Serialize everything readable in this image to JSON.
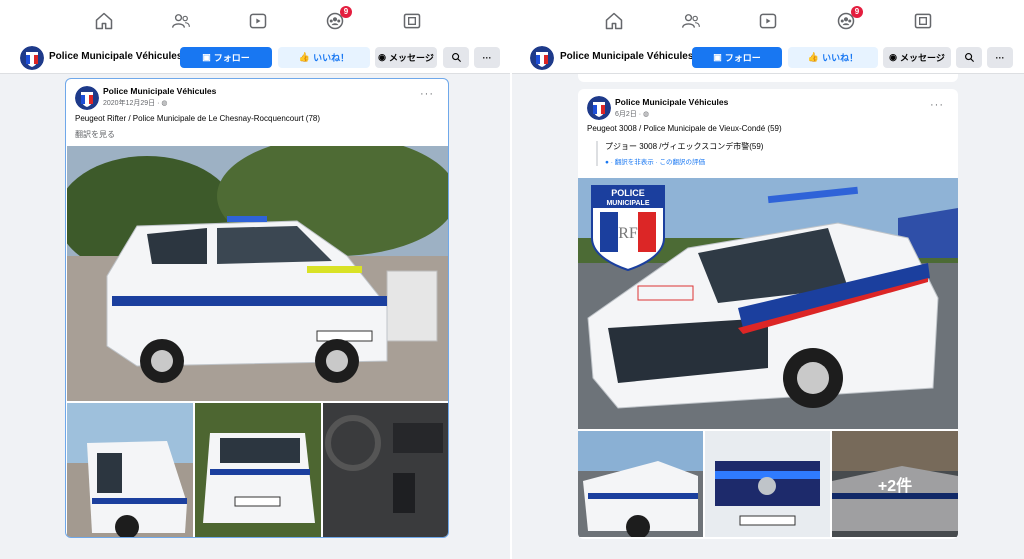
{
  "colors": {
    "accent": "#1877f2",
    "notification": "#e41e3f",
    "background": "#f0f2f5"
  },
  "nav": {
    "icons": [
      "home-icon",
      "friends-icon",
      "video-icon",
      "groups-icon",
      "gaming-icon"
    ],
    "notification_count": "9"
  },
  "page": {
    "name": "Police Municipale Véhicules",
    "follow_label": "フォロー",
    "like_label": "いいね！",
    "message_label": "メッセージ",
    "more_label": "···"
  },
  "posts": [
    {
      "author": "Police Municipale Véhicules",
      "date": "2020年12月29日 · ",
      "text": "Peugeot Rifter / Police Municipale de Le Chesnay-Rocquencourt (78)",
      "see_translation": "翻訳を見る",
      "menu": "···"
    },
    {
      "author": "Police Municipale Véhicules",
      "date": "6月2日 · ",
      "text": "Peugeot 3008 / Police Municipale de Vieux-Condé (59)",
      "translation": "プジョー 3008 /ヴィエックスコンデ市警(59)",
      "translation_links": "● · 翻訳を非表示 · この翻訳の評価",
      "menu": "···",
      "more_photos": "+2件",
      "decal": {
        "line1": "POLICE",
        "line2": "MUNICIPALE",
        "letters": "RF"
      }
    }
  ]
}
